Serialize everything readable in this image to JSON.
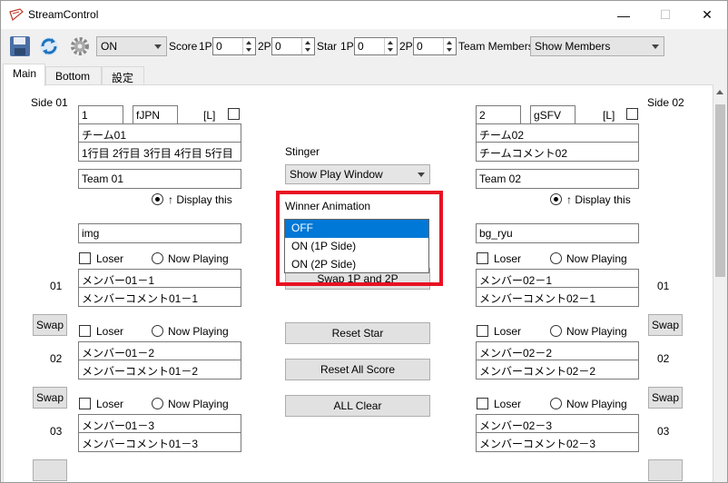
{
  "window": {
    "title": "StreamControl",
    "minimize_icon": "minimize-icon",
    "maximize_icon": "maximize-icon",
    "close_icon": "close-icon",
    "close_glyph": "✕",
    "minimize_glyph": "—",
    "maximize_glyph": "☐"
  },
  "toolbar": {
    "save_icon": "save-icon",
    "refresh_icon": "refresh-icon",
    "settings_icon": "gear-icon",
    "mode_select": "ON",
    "score_label": "Score",
    "score_1p_label": "1P",
    "score_1p_value": "0",
    "score_2p_label": "2P",
    "score_2p_value": "0",
    "star_label": "Star",
    "star_1p_label": "1P",
    "star_1p_value": "0",
    "star_2p_label": "2P",
    "star_2p_value": "0",
    "team_members_label": "Team Members",
    "team_members_select": "Show Members"
  },
  "tabs": [
    {
      "label": "Main",
      "active": true
    },
    {
      "label": "Bottom",
      "active": false
    },
    {
      "label": "設定",
      "active": false
    }
  ],
  "side1": {
    "heading": "Side 01",
    "number": "1",
    "country": "fJPN",
    "lock_label": "[L]",
    "team_name": "チーム01",
    "team_comment": "1行目 2行目 3行目 4行目 5行目",
    "team_label": "Team 01",
    "display_this": "↑ Display this",
    "image_field": "img",
    "members": [
      {
        "row_label": "01",
        "name": "メンバー01－1",
        "comment": "メンバーコメント01－1",
        "loser_label": "Loser",
        "now_playing_label": "Now Playing"
      },
      {
        "row_label": "02",
        "name": "メンバー01－2",
        "comment": "メンバーコメント01－2",
        "loser_label": "Loser",
        "now_playing_label": "Now Playing"
      },
      {
        "row_label": "03",
        "name": "メンバー01－3",
        "comment": "メンバーコメント01－3",
        "loser_label": "Loser",
        "now_playing_label": "Now Playing"
      }
    ]
  },
  "side2": {
    "heading": "Side 02",
    "number": "2",
    "country": "gSFV",
    "lock_label": "[L]",
    "team_name": "チーム02",
    "team_comment": "チームコメント02",
    "team_label": "Team 02",
    "display_this": "↑ Display this",
    "image_field": "bg_ryu",
    "members": [
      {
        "row_label": "01",
        "name": "メンバー02－1",
        "comment": "メンバーコメント02－1",
        "loser_label": "Loser",
        "now_playing_label": "Now Playing"
      },
      {
        "row_label": "02",
        "name": "メンバー02－2",
        "comment": "メンバーコメント02－2",
        "loser_label": "Loser",
        "now_playing_label": "Now Playing"
      },
      {
        "row_label": "03",
        "name": "メンバー02－3",
        "comment": "メンバーコメント02－3",
        "loser_label": "Loser",
        "now_playing_label": "Now Playing"
      }
    ]
  },
  "swap_label": "Swap",
  "center": {
    "stinger_label": "Stinger",
    "stinger_select": "Show Play Window",
    "winner_animation_label": "Winner Animation",
    "winner_options": [
      "OFF",
      "ON (1P Side)",
      "ON (2P Side)"
    ],
    "winner_selected": "OFF",
    "swap_1p_2p": "Swap 1P and 2P",
    "reset_star": "Reset Star",
    "reset_all_score": "Reset All Score",
    "all_clear": "ALL Clear"
  },
  "colors": {
    "highlight": "#e81123",
    "selection": "#0078d7"
  }
}
